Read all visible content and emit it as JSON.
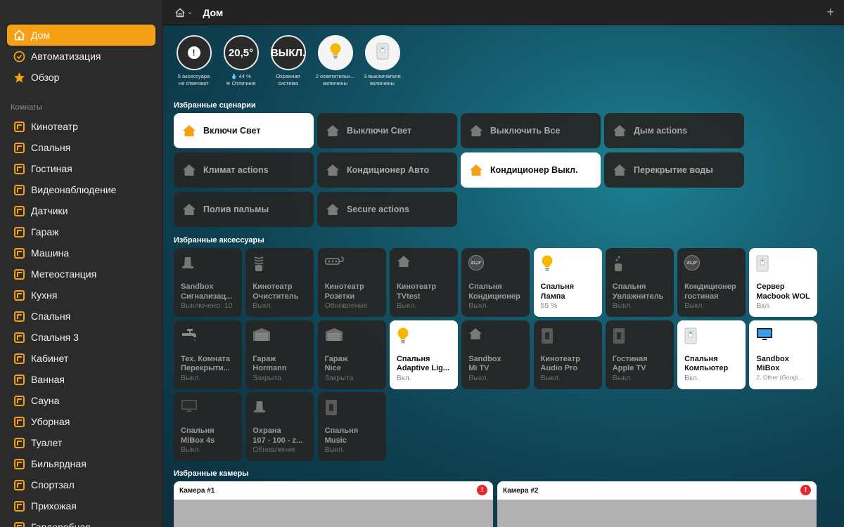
{
  "topbar": {
    "title": "Дом",
    "add": "+"
  },
  "sidebar": {
    "nav": [
      {
        "label": "Дом",
        "icon": "house-icon",
        "active": true
      },
      {
        "label": "Автоматизация",
        "icon": "clock-icon"
      },
      {
        "label": "Обзор",
        "icon": "star-icon"
      }
    ],
    "rooms_label": "Комнаты",
    "rooms": [
      "Кинотеатр",
      "Спальня",
      "Гостиная",
      "Видеонаблюдение",
      "Датчики",
      "Гараж",
      "Машина",
      "Метеостанция",
      "Кухня",
      "Спальня",
      "Спальня 3",
      "Кабинет",
      "Ванная",
      "Сауна",
      "Уборная",
      "Туалет",
      "Бильярдная",
      "Спортзал",
      "Прихожая",
      "Гардеробная"
    ]
  },
  "status": [
    {
      "value": "!",
      "line1": "5 аксессуара",
      "line2": "не отвечают"
    },
    {
      "value": "20,5°",
      "line1": "💧 44 %",
      "line2": "≋ Отличное"
    },
    {
      "value": "ВЫКЛ.",
      "line1": "Охранная",
      "line2": "система"
    },
    {
      "value": "",
      "icon": "bulb-icon",
      "line1": "2 осветительн...",
      "line2": "включены"
    },
    {
      "value": "",
      "icon": "switch-icon",
      "line1": "3 выключателя",
      "line2": "включены"
    }
  ],
  "scenes_title": "Избранные сценарии",
  "scenes": [
    {
      "label": "Включи Свет",
      "on": true
    },
    {
      "label": "Выключи Свет",
      "on": false
    },
    {
      "label": "Выключить Все",
      "on": false
    },
    {
      "label": "Дым actions",
      "on": false
    },
    {
      "label": "Климат actions",
      "on": false
    },
    {
      "label": "Кондиционер Авто",
      "on": false
    },
    {
      "label": "Кондиционер Выкл.",
      "on": true
    },
    {
      "label": "Перекрытие воды",
      "on": false
    },
    {
      "label": "Полив пальмы",
      "on": false
    },
    {
      "label": "Secure actions",
      "on": false
    }
  ],
  "accessories_title": "Избранные аксессуары",
  "accessories": [
    {
      "n1": "Sandbox",
      "n2": "Сигнализац...",
      "state": "Выключено: 10",
      "icon": "siren-icon",
      "on": false
    },
    {
      "n1": "Кинотеатр",
      "n2": "Очиститель",
      "state": "Выкл.",
      "icon": "purifier-icon",
      "on": false
    },
    {
      "n1": "Кинотеатр",
      "n2": "Розетки",
      "state": "Обновление",
      "icon": "power-strip-icon",
      "on": false
    },
    {
      "n1": "Кинотеатр",
      "n2": "TVtest",
      "state": "Выкл.",
      "icon": "house-icon",
      "on": false
    },
    {
      "n1": "Спальня",
      "n2": "Кондиционер",
      "state": "Выкл.",
      "icon": "thermostat-icon",
      "temp": "21,0°",
      "on": false
    },
    {
      "n1": "Спальня",
      "n2": "Лампа",
      "state": "55 %",
      "icon": "bulb-icon",
      "on": true
    },
    {
      "n1": "Спальня",
      "n2": "Увлажнитель",
      "state": "Выкл.",
      "icon": "humidifier-icon",
      "on": false
    },
    {
      "n1": "Кондиционер",
      "n2": "гостиная",
      "state": "Выкл.",
      "icon": "thermostat-icon",
      "temp": "21,0°",
      "on": false
    },
    {
      "n1": "Сервер",
      "n2": "Macbook WOL",
      "state": "Вкл.",
      "icon": "switch-icon",
      "on": true
    },
    {
      "n1": "Тех. Комната",
      "n2": "Перекрыти...",
      "state": "Выкл.",
      "icon": "faucet-icon",
      "on": false
    },
    {
      "n1": "Гараж",
      "n2": "Hormann",
      "state": "Закрыта",
      "icon": "garage-icon",
      "on": false
    },
    {
      "n1": "Гараж",
      "n2": "Nice",
      "state": "Закрыта",
      "icon": "garage-icon",
      "on": false
    },
    {
      "n1": "Спальня",
      "n2": "Adaptive Lig...",
      "state": "Вкл.",
      "icon": "bulb-icon",
      "on": true
    },
    {
      "n1": "Sandbox",
      "n2": "Mi TV",
      "state": "Выкл.",
      "icon": "house-icon",
      "on": false
    },
    {
      "n1": "Кинотеатр",
      "n2": "Audio Pro",
      "state": "Выкл.",
      "icon": "switch-icon",
      "on": false
    },
    {
      "n1": "Гостиная",
      "n2": "Apple TV",
      "state": "Выкл.",
      "icon": "switch-icon",
      "on": false
    },
    {
      "n1": "Спальня",
      "n2": "Компьютер",
      "state": "Вкл.",
      "icon": "switch-icon",
      "on": true
    },
    {
      "n1": "Sandbox",
      "n2": "MiBox",
      "state": "2. Other (Googl...",
      "icon": "tv-icon",
      "on": true,
      "small": true
    },
    {
      "n1": "Спальня",
      "n2": "MiBox 4s",
      "state": "Выкл.",
      "icon": "tv-icon",
      "on": false
    },
    {
      "n1": "Охрана",
      "n2": "107 - 100 - z...",
      "state": "Обновление",
      "icon": "siren-icon",
      "on": false
    },
    {
      "n1": "Спальня",
      "n2": "Music",
      "state": "Выкл.",
      "icon": "switch-icon",
      "on": false
    }
  ],
  "cameras_title": "Избранные камеры",
  "cameras": [
    {
      "title": "Камера #1",
      "alert": "!"
    },
    {
      "title": "Камера #2",
      "alert": "!"
    }
  ],
  "colors": {
    "accent": "#f5a015",
    "bulb": "#f5b800",
    "alert": "#e5262b"
  }
}
